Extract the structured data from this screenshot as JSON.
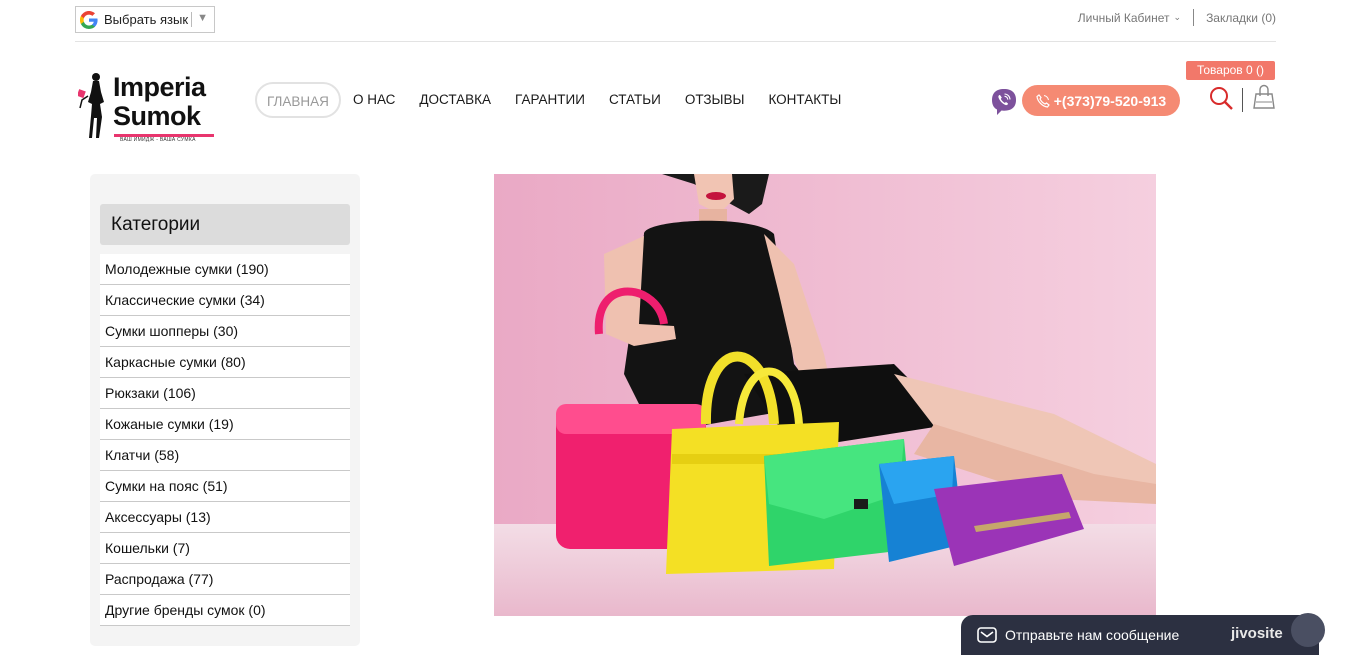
{
  "topbar": {
    "language_label": "Выбрать язык",
    "account_label": "Личный Кабинет",
    "bookmarks_label": "Закладки (0)"
  },
  "logo": {
    "line1": "Imperia",
    "line2": "Sumok",
    "tagline": "ВАШ ИМИДЖ - ВАША СУМКА"
  },
  "nav": {
    "items": [
      {
        "label": "ГЛАВНАЯ",
        "active": true
      },
      {
        "label": "О НАС"
      },
      {
        "label": "ДОСТАВКА"
      },
      {
        "label": "ГАРАНТИИ"
      },
      {
        "label": "СТАТЬИ"
      },
      {
        "label": "ОТЗЫВЫ"
      },
      {
        "label": "КОНТАКТЫ"
      }
    ]
  },
  "header": {
    "phone": "+(373)79-520-913",
    "cart_badge": "Товаров 0 ()"
  },
  "sidebar": {
    "title": "Категории",
    "categories": [
      "Молодежные сумки (190)",
      "Классические сумки (34)",
      "Сумки шопперы (30)",
      "Каркасные сумки (80)",
      "Рюкзаки (106)",
      "Кожаные сумки (19)",
      "Клатчи (58)",
      "Сумки на пояс (51)",
      "Аксессуары (13)",
      "Кошельки (7)",
      "Распродажа (77)",
      "Другие бренды сумок (0)"
    ]
  },
  "chat": {
    "label": "Отправьте нам сообщение",
    "brand": "jivosite"
  },
  "colors": {
    "accent": "#f58a73",
    "badge": "#f2786a",
    "logo_pink": "#e8356e",
    "banner_bg": "#f0bcd2",
    "chat_bg": "#2c3041"
  }
}
